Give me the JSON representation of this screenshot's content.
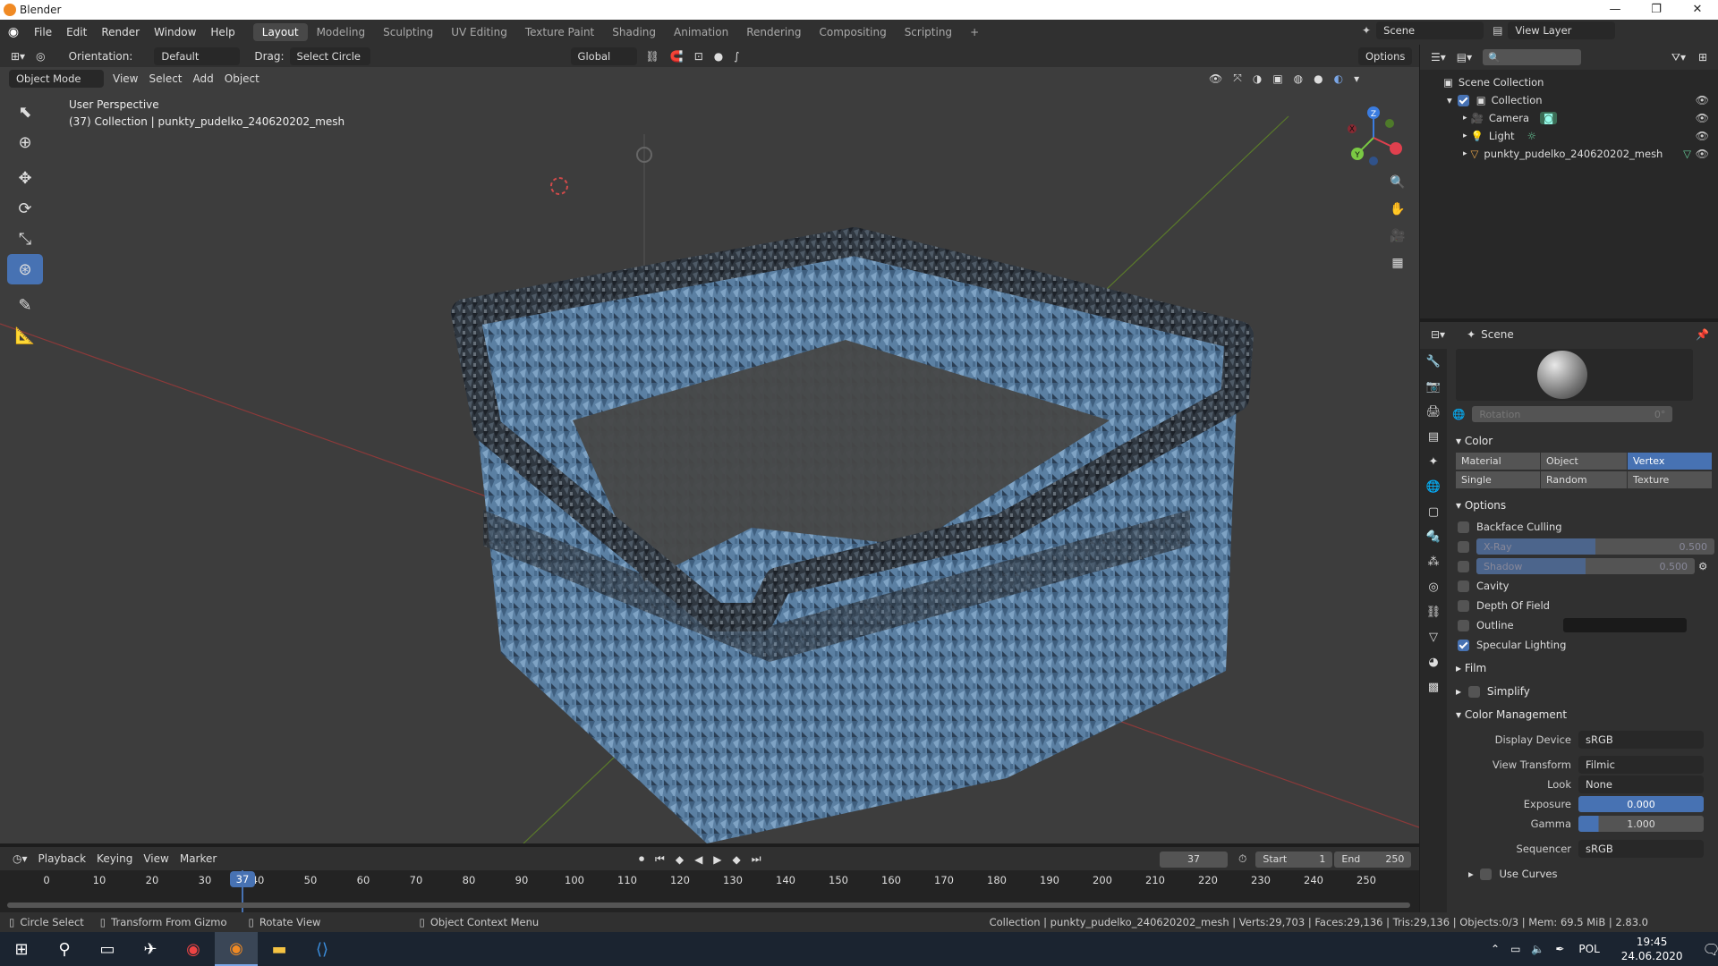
{
  "window": {
    "title": "Blender",
    "min": "—",
    "max": "❐",
    "close": "✕"
  },
  "menu": {
    "items": [
      "File",
      "Edit",
      "Render",
      "Window",
      "Help"
    ],
    "workspaces": [
      "Layout",
      "Modeling",
      "Sculpting",
      "UV Editing",
      "Texture Paint",
      "Shading",
      "Animation",
      "Rendering",
      "Compositing",
      "Scripting"
    ],
    "add_tab": "+",
    "scene_name": "Scene",
    "view_layer": "View Layer"
  },
  "tool_header": {
    "orientation_label": "Orientation:",
    "orientation_value": "Default",
    "drag_label": "Drag:",
    "drag_value": "Select Circle",
    "transform_orientation": "Global",
    "options": "Options"
  },
  "viewport_header": {
    "mode": "Object Mode",
    "menus": [
      "View",
      "Select",
      "Add",
      "Object"
    ]
  },
  "viewport": {
    "perspective": "User Perspective",
    "collection_info": "(37) Collection | punkty_pudelko_240620202_mesh",
    "gizmo": {
      "x": "X",
      "y": "Y",
      "z": "Z"
    }
  },
  "outliner": {
    "search_placeholder": "",
    "root": "Scene Collection",
    "collection": "Collection",
    "items": [
      "Camera",
      "Light",
      "punkty_pudelko_240620202_mesh"
    ]
  },
  "properties": {
    "context": "Scene",
    "rotation_label": "Rotation",
    "rotation_value": "0°",
    "color_section": "Color",
    "color_options": [
      "Material",
      "Object",
      "Vertex",
      "Single",
      "Random",
      "Texture"
    ],
    "color_active": "Vertex",
    "options_section": "Options",
    "backface_culling": "Backface Culling",
    "xray_label": "X-Ray",
    "xray_value": "0.500",
    "xray_fraction": 0.5,
    "shadow_label": "Shadow",
    "shadow_value": "0.500",
    "shadow_fraction": 0.5,
    "cavity": "Cavity",
    "depth_of_field": "Depth Of Field",
    "outline": "Outline",
    "specular_lighting": "Specular Lighting",
    "film_section": "Film",
    "simplify_section": "Simplify",
    "color_management_section": "Color Management",
    "display_device_label": "Display Device",
    "display_device_value": "sRGB",
    "view_transform_label": "View Transform",
    "view_transform_value": "Filmic",
    "look_label": "Look",
    "look_value": "None",
    "exposure_label": "Exposure",
    "exposure_value": "0.000",
    "gamma_label": "Gamma",
    "gamma_value": "1.000",
    "sequencer_label": "Sequencer",
    "sequencer_value": "sRGB",
    "use_curves": "Use Curves"
  },
  "timeline": {
    "menus": [
      "Playback",
      "Keying",
      "View",
      "Marker"
    ],
    "current_frame": "37",
    "start_label": "Start",
    "start_value": "1",
    "end_label": "End",
    "end_value": "250",
    "ticks": [
      "0",
      "10",
      "20",
      "30",
      "40",
      "50",
      "60",
      "70",
      "80",
      "90",
      "100",
      "110",
      "120",
      "130",
      "140",
      "150",
      "160",
      "170",
      "180",
      "190",
      "200",
      "210",
      "220",
      "230",
      "240",
      "250"
    ],
    "playhead_label": "37"
  },
  "status": {
    "circle_select": "Circle Select",
    "transform_gizmo": "Transform From Gizmo",
    "rotate_view": "Rotate View",
    "context_menu": "Object Context Menu",
    "stats": "Collection | punkty_pudelko_240620202_mesh | Verts:29,703 | Faces:29,136 | Tris:29,136 | Objects:0/3 | Mem: 69.5 MiB | 2.83.0"
  },
  "taskbar": {
    "lang": "POL",
    "time": "19:45",
    "date": "24.06.2020"
  },
  "colors": {
    "accent": "#4772b3",
    "mesh": "#5b7fa0",
    "bg": "#3d3d3d"
  }
}
